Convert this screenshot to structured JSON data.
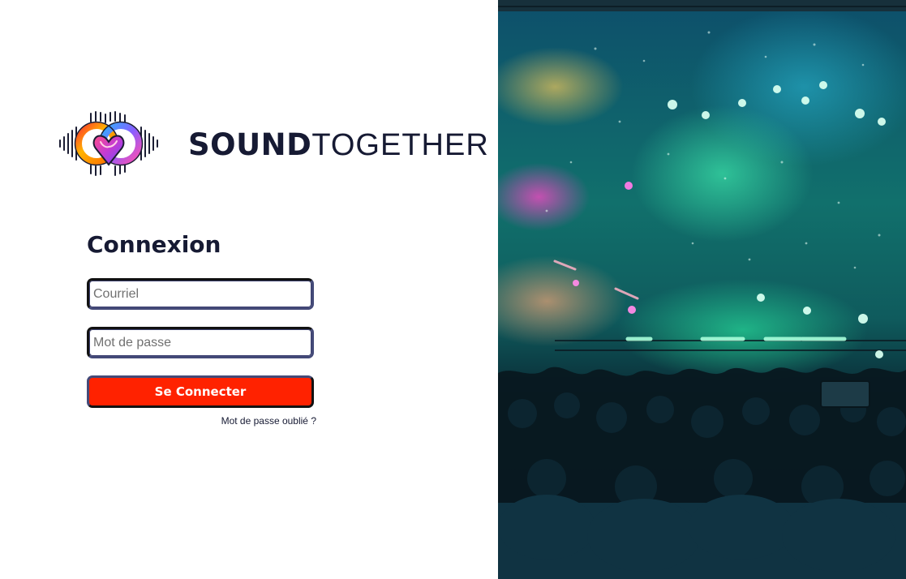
{
  "brand": {
    "name_bold": "SOUND",
    "name_light": "TOGETHER"
  },
  "login": {
    "title": "Connexion",
    "email_placeholder": "Courriel",
    "password_placeholder": "Mot de passe",
    "submit_label": "Se Connecter",
    "forgot_label": "Mot de passe oublié ?"
  },
  "colors": {
    "text_dark": "#161a33",
    "button_bg": "#ff2200",
    "field_border": "#444a78"
  },
  "icons": {
    "logo": "sound-heart-logo-icon"
  }
}
